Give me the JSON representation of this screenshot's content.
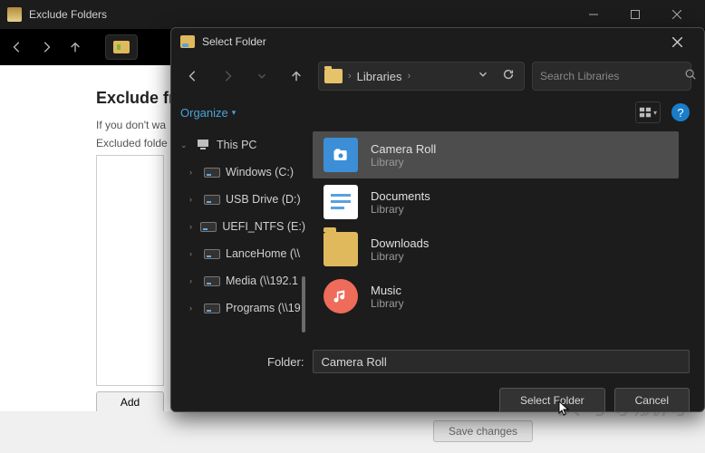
{
  "parent": {
    "title": "Exclude Folders",
    "heading": "Exclude fro",
    "desc": "If you don't wa",
    "excluded_label": "Excluded folde",
    "add_label": "Add",
    "save_label": "Save changes"
  },
  "dialog": {
    "title": "Select Folder",
    "breadcrumb": "Libraries",
    "search_placeholder": "Search Libraries",
    "organize": "Organize",
    "help_glyph": "?",
    "folder_label": "Folder:",
    "folder_value": "Camera Roll",
    "select_btn": "Select Folder",
    "cancel_btn": "Cancel"
  },
  "tree": {
    "pc": "This PC",
    "items": [
      {
        "label": "Windows (C:)"
      },
      {
        "label": "USB Drive (D:)"
      },
      {
        "label": "UEFI_NTFS (E:)"
      },
      {
        "label": "LanceHome (\\\\"
      },
      {
        "label": "Media (\\\\192.1"
      },
      {
        "label": "Programs (\\\\19"
      }
    ]
  },
  "libraries": [
    {
      "name": "Camera Roll",
      "sub": "Library",
      "kind": "camera",
      "selected": true
    },
    {
      "name": "Documents",
      "sub": "Library",
      "kind": "docs",
      "selected": false
    },
    {
      "name": "Downloads",
      "sub": "Library",
      "kind": "down",
      "selected": false
    },
    {
      "name": "Music",
      "sub": "Library",
      "kind": "music",
      "selected": false
    }
  ],
  "watermark": "快马导航网"
}
